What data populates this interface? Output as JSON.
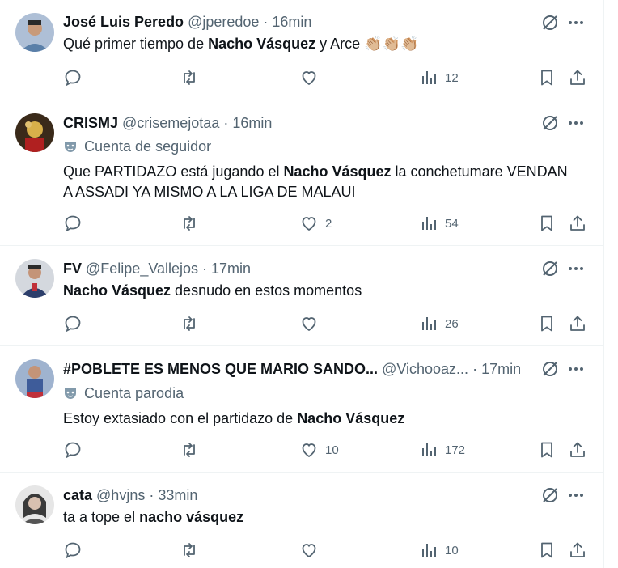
{
  "tweets": [
    {
      "name": "José Luis Peredo",
      "handle": "@jperedoe",
      "time": "16min",
      "badge": "",
      "body": [
        {
          "t": "Qué primer tiempo de ",
          "b": false
        },
        {
          "t": "Nacho Vásquez",
          "b": true
        },
        {
          "t": " y Arce 👏🏼👏🏼👏🏼",
          "b": false
        }
      ],
      "likes": "",
      "views": "12",
      "avatar_color": "#5a7fa8"
    },
    {
      "name": "CRISMJ",
      "handle": "@crisemejotaa",
      "time": "16min",
      "badge": "Cuenta de seguidor",
      "body": [
        {
          "t": "Que PARTIDAZO está jugando el ",
          "b": false
        },
        {
          "t": "Nacho Vásquez",
          "b": true
        },
        {
          "t": " la conchetumare VENDAN A ASSADI YA MISMO A LA LIGA DE MALAUI",
          "b": false
        }
      ],
      "likes": "2",
      "views": "54",
      "avatar_color": "#8a6d2b"
    },
    {
      "name": "FV",
      "handle": "@Felipe_Vallejos",
      "time": "17min",
      "badge": "",
      "body": [
        {
          "t": "Nacho Vásquez",
          "b": true
        },
        {
          "t": " desnudo en estos momentos",
          "b": false
        }
      ],
      "likes": "",
      "views": "26",
      "avatar_color": "#2c3e6b"
    },
    {
      "name": "#POBLETE ES MENOS QUE MARIO SANDO...",
      "handle": "@Vichooaz...",
      "time": "17min",
      "badge": "Cuenta parodia",
      "body": [
        {
          "t": "Estoy extasiado con el partidazo de ",
          "b": false
        },
        {
          "t": "Nacho Vásquez",
          "b": true
        }
      ],
      "likes": "10",
      "views": "172",
      "avatar_color": "#3e5c9a"
    },
    {
      "name": "cata",
      "handle": "@hvjns",
      "time": "33min",
      "badge": "",
      "body": [
        {
          "t": "ta a tope el ",
          "b": false
        },
        {
          "t": "nacho vásquez",
          "b": true
        }
      ],
      "likes": "",
      "views": "10",
      "avatar_color": "#9a9a9a"
    }
  ]
}
